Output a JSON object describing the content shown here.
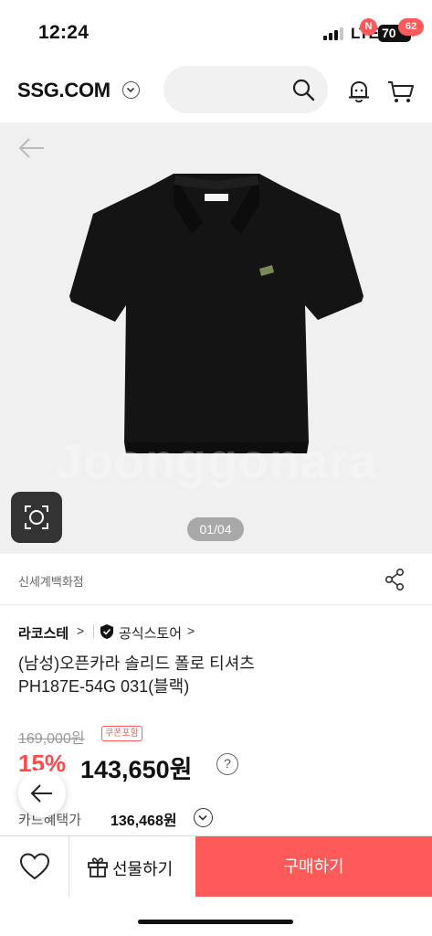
{
  "status_bar": {
    "time": "12:24",
    "network": "LTE",
    "battery": "70"
  },
  "header": {
    "logo": "SSG.COM",
    "notification_badge": "N",
    "cart_count": "62"
  },
  "gallery": {
    "watermark": "Joonggonara",
    "pager": "01/04"
  },
  "store": {
    "name": "신세계백화점"
  },
  "brand": {
    "name": "라코스테",
    "chevron": ">",
    "official_label": "공식스토어",
    "official_chevron": ">"
  },
  "product": {
    "title_line1": "(남성)오픈카라 솔리드 폴로 티셔츠",
    "title_line2": "PH187E-54G  031(블랙)"
  },
  "price": {
    "original": "169,000원",
    "coupon_tag": "쿠폰포함",
    "discount": "15%",
    "sale": "143,650원",
    "info_glyph": "?"
  },
  "card": {
    "label": "카드혜택가",
    "price": "136,468원"
  },
  "bottom_bar": {
    "gift_label": "선물하기",
    "buy_label": "구매하기"
  },
  "colors": {
    "accent": "#ff5a5a",
    "gallery_bg": "#f0f0f0"
  },
  "icons": [
    "search-icon",
    "bell-icon",
    "cart-icon",
    "back-arrow-icon",
    "lens-icon",
    "share-icon",
    "verified-shield-icon",
    "heart-icon",
    "gift-icon"
  ]
}
